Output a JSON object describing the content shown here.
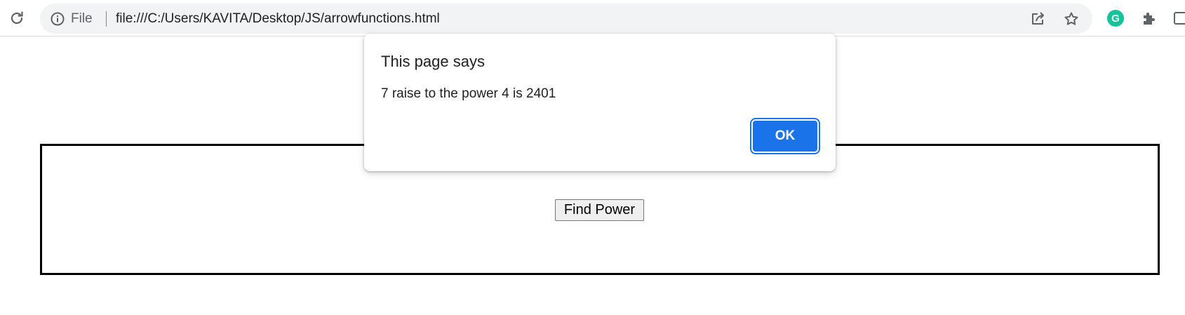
{
  "browser": {
    "site_info_label": "File",
    "url": "file:///C:/Users/KAVITA/Desktop/JS/arrowfunctions.html",
    "icons": {
      "reload": "reload-icon",
      "site_info": "info-icon",
      "share": "share-icon",
      "bookmark": "star-icon",
      "grammarly": "grammarly-icon",
      "extensions": "puzzle-icon",
      "side_panel": "side-panel-icon"
    },
    "grammarly_letter": "G"
  },
  "page": {
    "button_label": "Find Power"
  },
  "dialog": {
    "title": "This page says",
    "message": "7 raise to the power 4 is 2401",
    "ok_label": "OK"
  },
  "colors": {
    "accent": "#1a73e8",
    "omnibox_bg": "#f1f3f4",
    "grammarly": "#15c39a"
  }
}
